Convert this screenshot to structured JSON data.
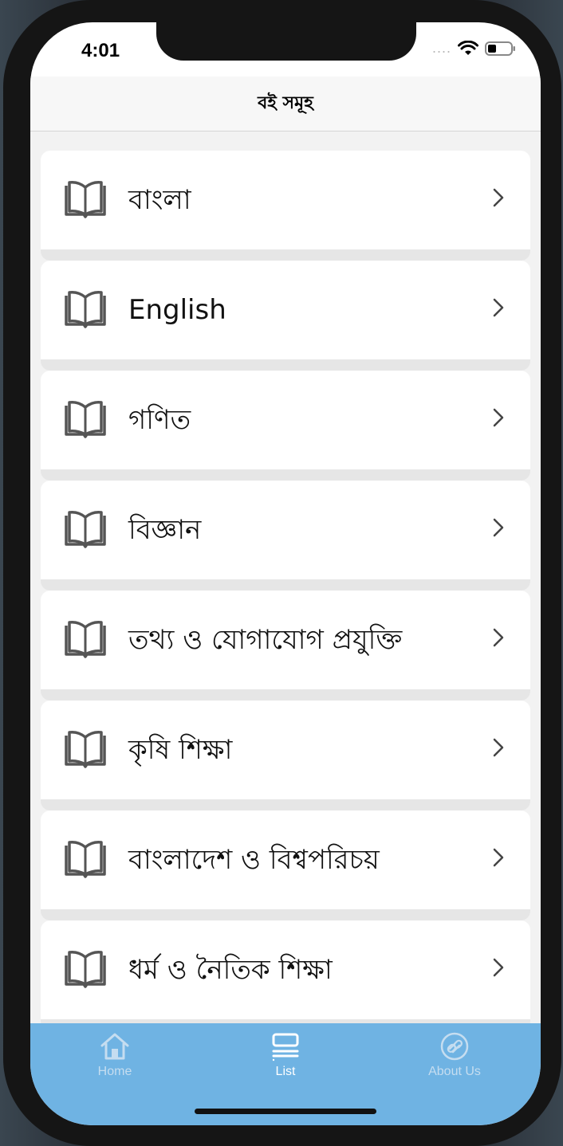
{
  "status_bar": {
    "time": "4:01",
    "signal": "....",
    "wifi_icon": "wifi-icon",
    "battery_icon": "battery-icon"
  },
  "navbar": {
    "title": "বই সমূহ"
  },
  "books": [
    {
      "label": "বাংলা",
      "icon": "book-open-icon"
    },
    {
      "label": "English",
      "icon": "book-open-icon"
    },
    {
      "label": "গণিত",
      "icon": "book-open-icon"
    },
    {
      "label": "বিজ্ঞান",
      "icon": "book-open-icon"
    },
    {
      "label": "তথ্য ও যোগাযোগ প্রযুক্তি",
      "icon": "book-open-icon"
    },
    {
      "label": "কৃষি শিক্ষা",
      "icon": "book-open-icon"
    },
    {
      "label": "বাংলাদেশ ও বিশ্বপরিচয়",
      "icon": "book-open-icon"
    },
    {
      "label": "ধর্ম ও নৈতিক শিক্ষা",
      "icon": "book-open-icon"
    }
  ],
  "tabbar": {
    "tabs": [
      {
        "label": "Home",
        "icon": "home-icon",
        "active": false
      },
      {
        "label": "List",
        "icon": "list-icon",
        "active": true
      },
      {
        "label": "About Us",
        "icon": "link-icon",
        "active": false
      }
    ],
    "background": "#6fb3e3"
  }
}
